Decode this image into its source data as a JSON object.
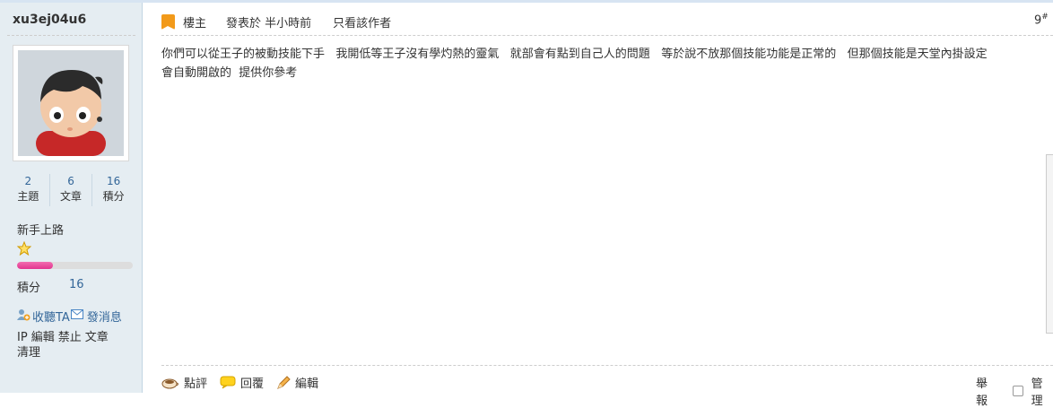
{
  "user": {
    "name": "xu3ej04u6",
    "stats": [
      {
        "value": "2",
        "label": "主題"
      },
      {
        "value": "6",
        "label": "文章"
      },
      {
        "value": "16",
        "label": "積分"
      }
    ],
    "group": "新手上路",
    "level_progress": 0.31,
    "credit_label": "積分",
    "credit_value": "16",
    "follow_label": "收聽TA",
    "message_label": "發消息",
    "admin_links": [
      "IP",
      "編輯",
      "禁止",
      "文章",
      "清理"
    ]
  },
  "post": {
    "owner_label": "樓主",
    "posted_label": "發表於 半小時前",
    "only_author_label": "只看該作者",
    "floor_number": "9",
    "floor_suffix": "#",
    "content": "你們可以從王子的被動技能下手   我開低等王子沒有學灼熱的靈氣   就部會有點到自己人的問題   等於說不放那個技能功能是正常的   但那個技能是天堂內掛設定\n會自動開啟的  提供你參考"
  },
  "footer": {
    "rate_label": "點評",
    "reply_label": "回覆",
    "edit_label": "編輯",
    "report_label": "舉報",
    "manage_label": "管理"
  },
  "icons": [
    "user-icon",
    "star-icon",
    "follow-icon",
    "mail-icon",
    "owner-icon",
    "rate-icon",
    "reply-icon",
    "edit-icon"
  ],
  "colors": {
    "link": "#336699",
    "sidebar_bg": "#e5edf2",
    "progress": "#e2348f",
    "owner_badge": "#f29a1a"
  }
}
